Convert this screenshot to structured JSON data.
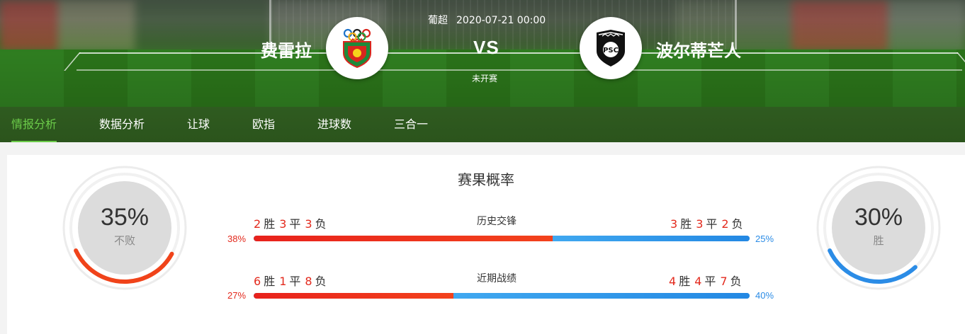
{
  "match": {
    "league": "葡超",
    "datetime": "2020-07-21 00:00",
    "vs": "VS",
    "status": "未开赛",
    "home": {
      "name": "费雷拉",
      "logo_icon": "pacos-ferreira-crest-icon"
    },
    "away": {
      "name": "波尔蒂芒人",
      "logo_icon": "portimonense-crest-icon"
    }
  },
  "tabs": [
    {
      "label": "情报分析",
      "active": true
    },
    {
      "label": "数据分析",
      "active": false
    },
    {
      "label": "让球",
      "active": false
    },
    {
      "label": "欧指",
      "active": false
    },
    {
      "label": "进球数",
      "active": false
    },
    {
      "label": "三合一",
      "active": false
    }
  ],
  "probability": {
    "title": "赛果概率",
    "left": {
      "percent": "35%",
      "value": 35,
      "label": "不败",
      "color": "#f0431a"
    },
    "right": {
      "percent": "30%",
      "value": 30,
      "label": "胜",
      "color": "#2b8ce6"
    },
    "rows": [
      {
        "label": "历史交锋",
        "home": {
          "w": "2",
          "d": "3",
          "l": "3",
          "pct": "38%",
          "value": 38
        },
        "away": {
          "w": "3",
          "d": "3",
          "l": "2",
          "pct": "25%",
          "value": 25
        }
      },
      {
        "label": "近期战绩",
        "home": {
          "w": "6",
          "d": "1",
          "l": "8",
          "pct": "27%",
          "value": 27
        },
        "away": {
          "w": "4",
          "d": "4",
          "l": "7",
          "pct": "40%",
          "value": 40
        }
      }
    ],
    "words": {
      "win": "胜",
      "draw": "平",
      "loss": "负"
    }
  },
  "colors": {
    "tab_active": "#6ccc4a",
    "home_accent": "#e32a1d",
    "away_accent": "#2b8ce6"
  }
}
